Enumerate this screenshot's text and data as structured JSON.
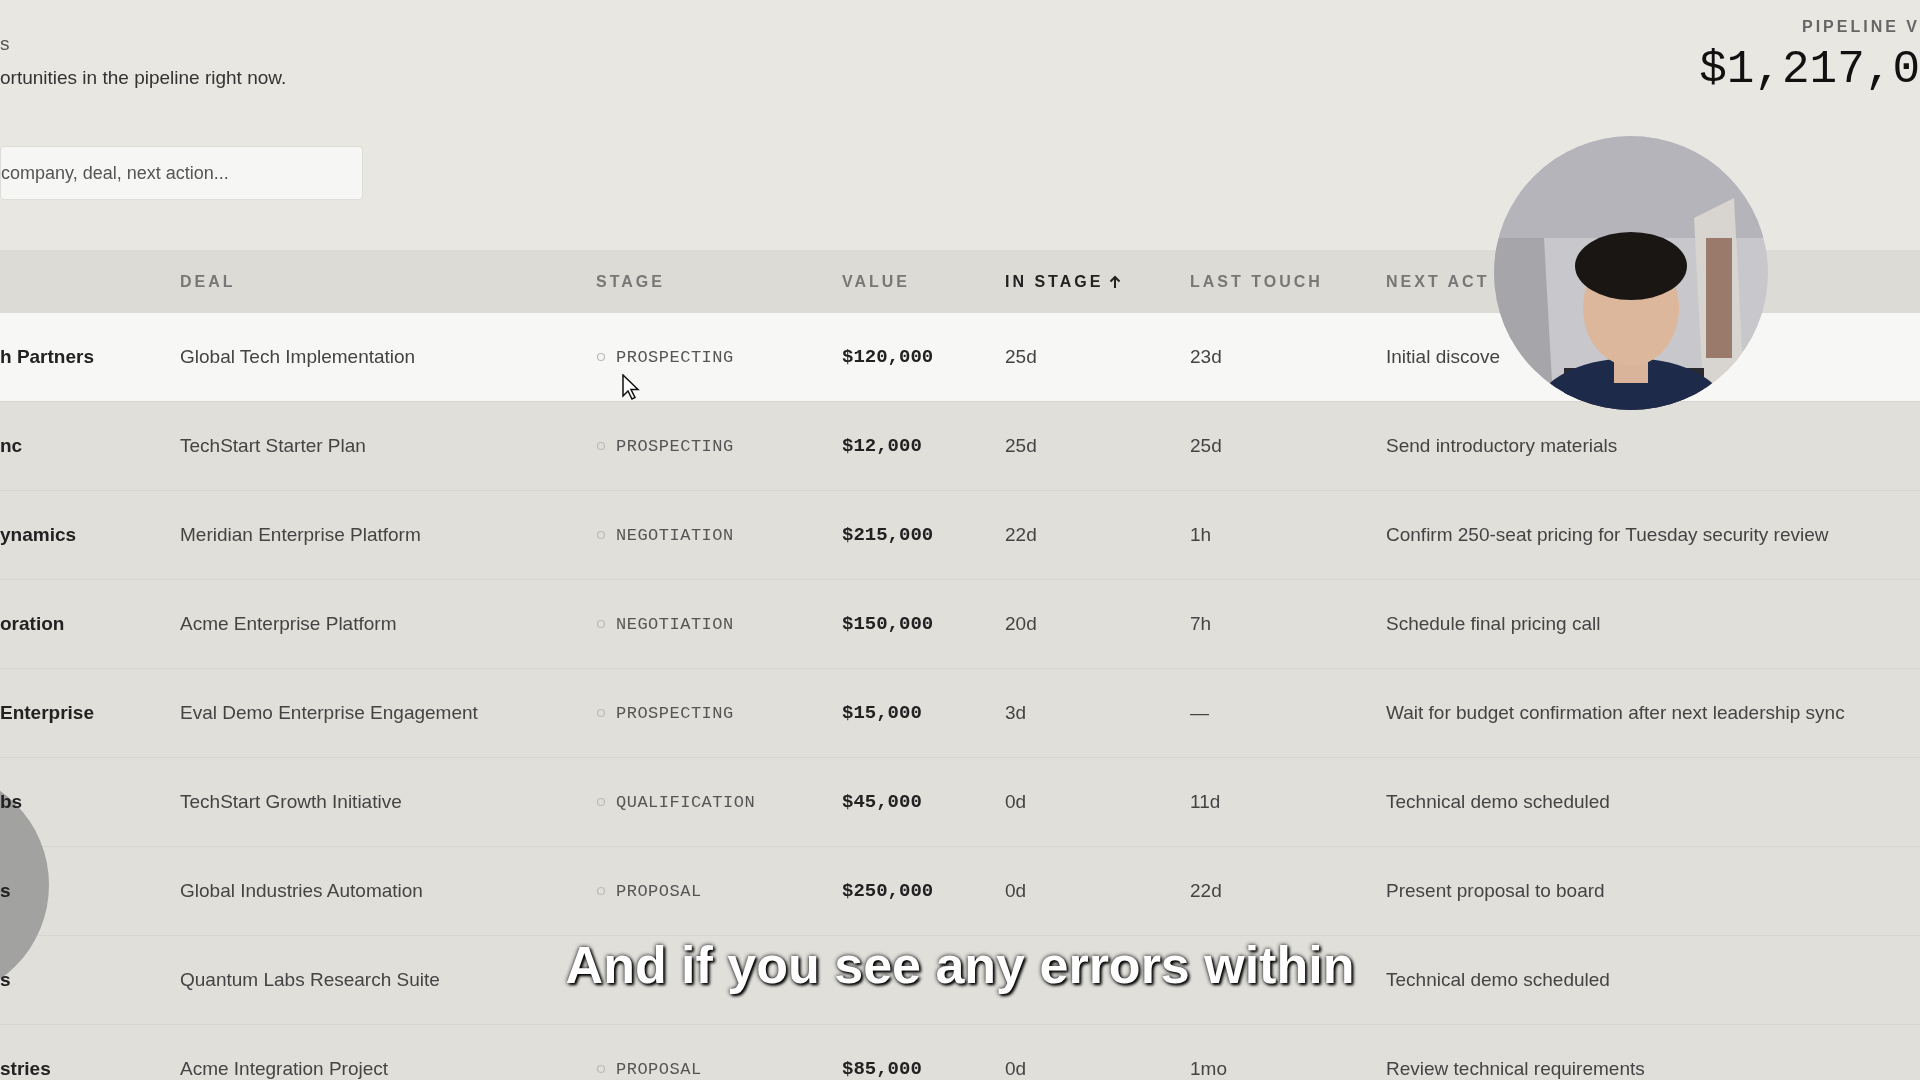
{
  "header": {
    "title": "s",
    "subtitle": "ortunities in the pipeline right now.",
    "pipeline_label": "PIPELINE V",
    "pipeline_value": "$1,217,0"
  },
  "search": {
    "placeholder": "company, deal, next action..."
  },
  "table": {
    "columns": [
      {
        "label": "DEAL",
        "sorted": false
      },
      {
        "label": "STAGE",
        "sorted": false
      },
      {
        "label": "VALUE",
        "sorted": false
      },
      {
        "label": "IN STAGE",
        "sorted": true
      },
      {
        "label": "LAST TOUCH",
        "sorted": false
      },
      {
        "label": "NEXT ACT",
        "sorted": false
      }
    ],
    "rows": [
      {
        "company": "h Partners",
        "deal": "Global Tech Implementation",
        "stage": "PROSPECTING",
        "value": "$120,000",
        "in_stage": "25d",
        "last_touch": "23d",
        "next_action": "Initial discove",
        "selected": true
      },
      {
        "company": "nc",
        "deal": "TechStart Starter Plan",
        "stage": "PROSPECTING",
        "value": "$12,000",
        "in_stage": "25d",
        "last_touch": "25d",
        "next_action": "Send introductory materials",
        "selected": false
      },
      {
        "company": "ynamics",
        "deal": "Meridian Enterprise Platform",
        "stage": "NEGOTIATION",
        "value": "$215,000",
        "in_stage": "22d",
        "last_touch": "1h",
        "next_action": "Confirm 250-seat pricing for Tuesday security review",
        "selected": false
      },
      {
        "company": "oration",
        "deal": "Acme Enterprise Platform",
        "stage": "NEGOTIATION",
        "value": "$150,000",
        "in_stage": "20d",
        "last_touch": "7h",
        "next_action": "Schedule final pricing call",
        "selected": false
      },
      {
        "company": "Enterprise",
        "deal": "Eval Demo Enterprise Engagement",
        "stage": "PROSPECTING",
        "value": "$15,000",
        "in_stage": "3d",
        "last_touch": "—",
        "next_action": "Wait for budget confirmation after next leadership sync",
        "selected": false
      },
      {
        "company": "bs",
        "deal": "TechStart Growth Initiative",
        "stage": "QUALIFICATION",
        "value": "$45,000",
        "in_stage": "0d",
        "last_touch": "11d",
        "next_action": "Technical demo scheduled",
        "selected": false
      },
      {
        "company": "s",
        "deal": "Global Industries Automation",
        "stage": "PROPOSAL",
        "value": "$250,000",
        "in_stage": "0d",
        "last_touch": "22d",
        "next_action": "Present proposal to board",
        "selected": false
      },
      {
        "company": "s",
        "deal": "Quantum Labs Research Suite",
        "next_action": "Technical demo scheduled",
        "selected": false
      },
      {
        "company": "stries",
        "deal": "Acme Integration Project",
        "stage": "PROPOSAL",
        "value": "$85,000",
        "in_stage": "0d",
        "last_touch": "1mo",
        "next_action": "Review technical requirements",
        "selected": false
      }
    ]
  },
  "subtitle": "And if you see any errors within"
}
